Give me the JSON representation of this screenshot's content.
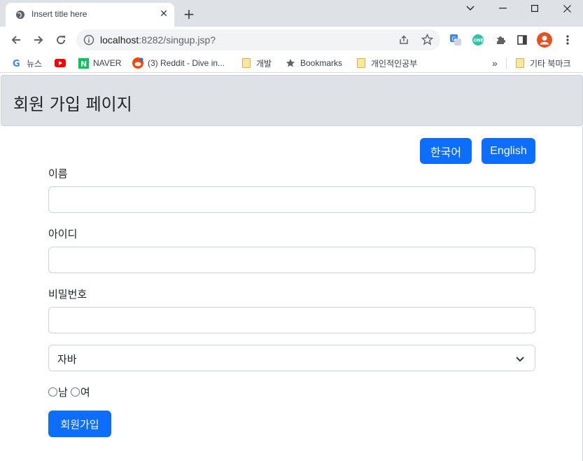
{
  "browser": {
    "tab_title": "Insert title here",
    "tab_close": "✕",
    "new_tab": "+",
    "url_host": "localhost",
    "url_rest": ":8282/singup.jsp?",
    "bookmarks": [
      {
        "label": "뉴스"
      },
      {
        "label": ""
      },
      {
        "label": "NAVER"
      },
      {
        "label": "(3) Reddit - Dive in..."
      },
      {
        "label": "개발"
      },
      {
        "label": "Bookmarks"
      },
      {
        "label": "개인적인공부"
      },
      {
        "label": "기타 북마크"
      }
    ],
    "overflow": "»"
  },
  "page": {
    "title": "회원 가입 페이지",
    "lang_korean": "한국어",
    "lang_english": "English",
    "name_label": "이름",
    "id_label": "아이디",
    "password_label": "비밀번호",
    "select_value": "자바",
    "radio_male": "남",
    "radio_female": "여",
    "submit": "회원가입"
  },
  "colors": {
    "primary": "#0d6efd",
    "header_bg": "#dee1e6"
  }
}
